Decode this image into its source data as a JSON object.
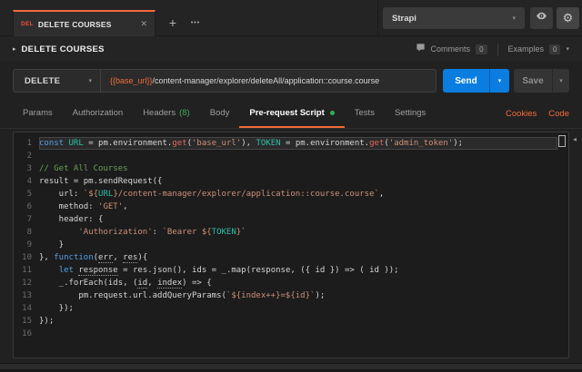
{
  "topbar": {
    "tab": {
      "method": "DEL",
      "title": "DELETE COURSES"
    },
    "environment": {
      "name": "Strapi"
    }
  },
  "icons": {
    "close": "✕",
    "plus": "+",
    "more": "•••",
    "caret": "▾",
    "collapse_arrow": "▸",
    "side_arrow": "◂",
    "gear": "⚙"
  },
  "request_header": {
    "title": "DELETE COURSES",
    "comments_label": "Comments",
    "comments_count": "0",
    "examples_label": "Examples",
    "examples_count": "0"
  },
  "request_bar": {
    "method": "DELETE",
    "url_variable": "{{base_url}}",
    "url_path": "/content-manager/explorer/deleteAll/application::course.course",
    "send_label": "Send",
    "save_label": "Save"
  },
  "tabs": {
    "items": [
      {
        "label": "Params"
      },
      {
        "label": "Authorization"
      },
      {
        "label": "Headers",
        "badge": "(8)"
      },
      {
        "label": "Body"
      },
      {
        "label": "Pre-request Script",
        "active": true,
        "dot": true
      },
      {
        "label": "Tests"
      },
      {
        "label": "Settings"
      }
    ],
    "links": [
      "Cookies",
      "Code"
    ]
  },
  "colors": {
    "accent_orange": "#f26b3a",
    "send_blue": "#0a7de0",
    "success_green": "#3fae54",
    "method_red": "#ef4b3e"
  },
  "editor": {
    "lines": [
      {
        "n": "1",
        "active": true,
        "t": [
          [
            "kw",
            "const"
          ],
          [
            "p",
            " "
          ],
          [
            "var",
            "URL"
          ],
          [
            "p",
            " = pm.environment."
          ],
          [
            "get",
            "get"
          ],
          [
            "p",
            "("
          ],
          [
            "str",
            "'base_url'"
          ],
          [
            "p",
            "), "
          ],
          [
            "var",
            "TOKEN"
          ],
          [
            "p",
            " = pm.environment."
          ],
          [
            "get",
            "get"
          ],
          [
            "p",
            "("
          ],
          [
            "str",
            "'admin_token'"
          ],
          [
            "p",
            ");"
          ]
        ]
      },
      {
        "n": "2",
        "t": []
      },
      {
        "n": "3",
        "t": [
          [
            "com",
            "// Get All Courses"
          ]
        ]
      },
      {
        "n": "4",
        "t": [
          [
            "p",
            "result = pm.sendRequest({"
          ]
        ]
      },
      {
        "n": "5",
        "t": [
          [
            "p",
            "    url: "
          ],
          [
            "str",
            "`${"
          ],
          [
            "var",
            "URL"
          ],
          [
            "str",
            "}/content-manager/explorer/application::course.course`"
          ],
          [
            "p",
            ","
          ]
        ]
      },
      {
        "n": "6",
        "t": [
          [
            "p",
            "    method: "
          ],
          [
            "str",
            "'GET'"
          ],
          [
            "p",
            ","
          ]
        ]
      },
      {
        "n": "7",
        "t": [
          [
            "p",
            "    header: {"
          ]
        ]
      },
      {
        "n": "8",
        "t": [
          [
            "p",
            "        "
          ],
          [
            "str",
            "'Authorization'"
          ],
          [
            "p",
            ": "
          ],
          [
            "str",
            "`Bearer ${"
          ],
          [
            "var",
            "TOKEN"
          ],
          [
            "str",
            "}`"
          ]
        ]
      },
      {
        "n": "9",
        "t": [
          [
            "p",
            "    }"
          ]
        ]
      },
      {
        "n": "10",
        "t": [
          [
            "p",
            "}, "
          ],
          [
            "kw",
            "function"
          ],
          [
            "p",
            "("
          ],
          [
            "pd",
            "err"
          ],
          [
            "p",
            ", "
          ],
          [
            "pd",
            "res"
          ],
          [
            "p",
            "){"
          ]
        ]
      },
      {
        "n": "11",
        "t": [
          [
            "p",
            "    "
          ],
          [
            "kw",
            "let"
          ],
          [
            "p",
            " "
          ],
          [
            "pd",
            "response"
          ],
          [
            "p",
            " = res.json(), ids = _.map(response, ({ id }) => ( id ));"
          ]
        ]
      },
      {
        "n": "12",
        "t": [
          [
            "p",
            "    _.forEach(ids, ("
          ],
          [
            "pd",
            "id"
          ],
          [
            "p",
            ", "
          ],
          [
            "pd",
            "index"
          ],
          [
            "p",
            ") => {"
          ]
        ]
      },
      {
        "n": "13",
        "t": [
          [
            "p",
            "        pm.request.url.addQueryParams("
          ],
          [
            "str",
            "`${index++}=${id}`"
          ],
          [
            "p",
            ");"
          ]
        ]
      },
      {
        "n": "14",
        "t": [
          [
            "p",
            "    });"
          ]
        ]
      },
      {
        "n": "15",
        "t": [
          [
            "p",
            "});"
          ]
        ]
      },
      {
        "n": "16",
        "t": []
      }
    ]
  }
}
